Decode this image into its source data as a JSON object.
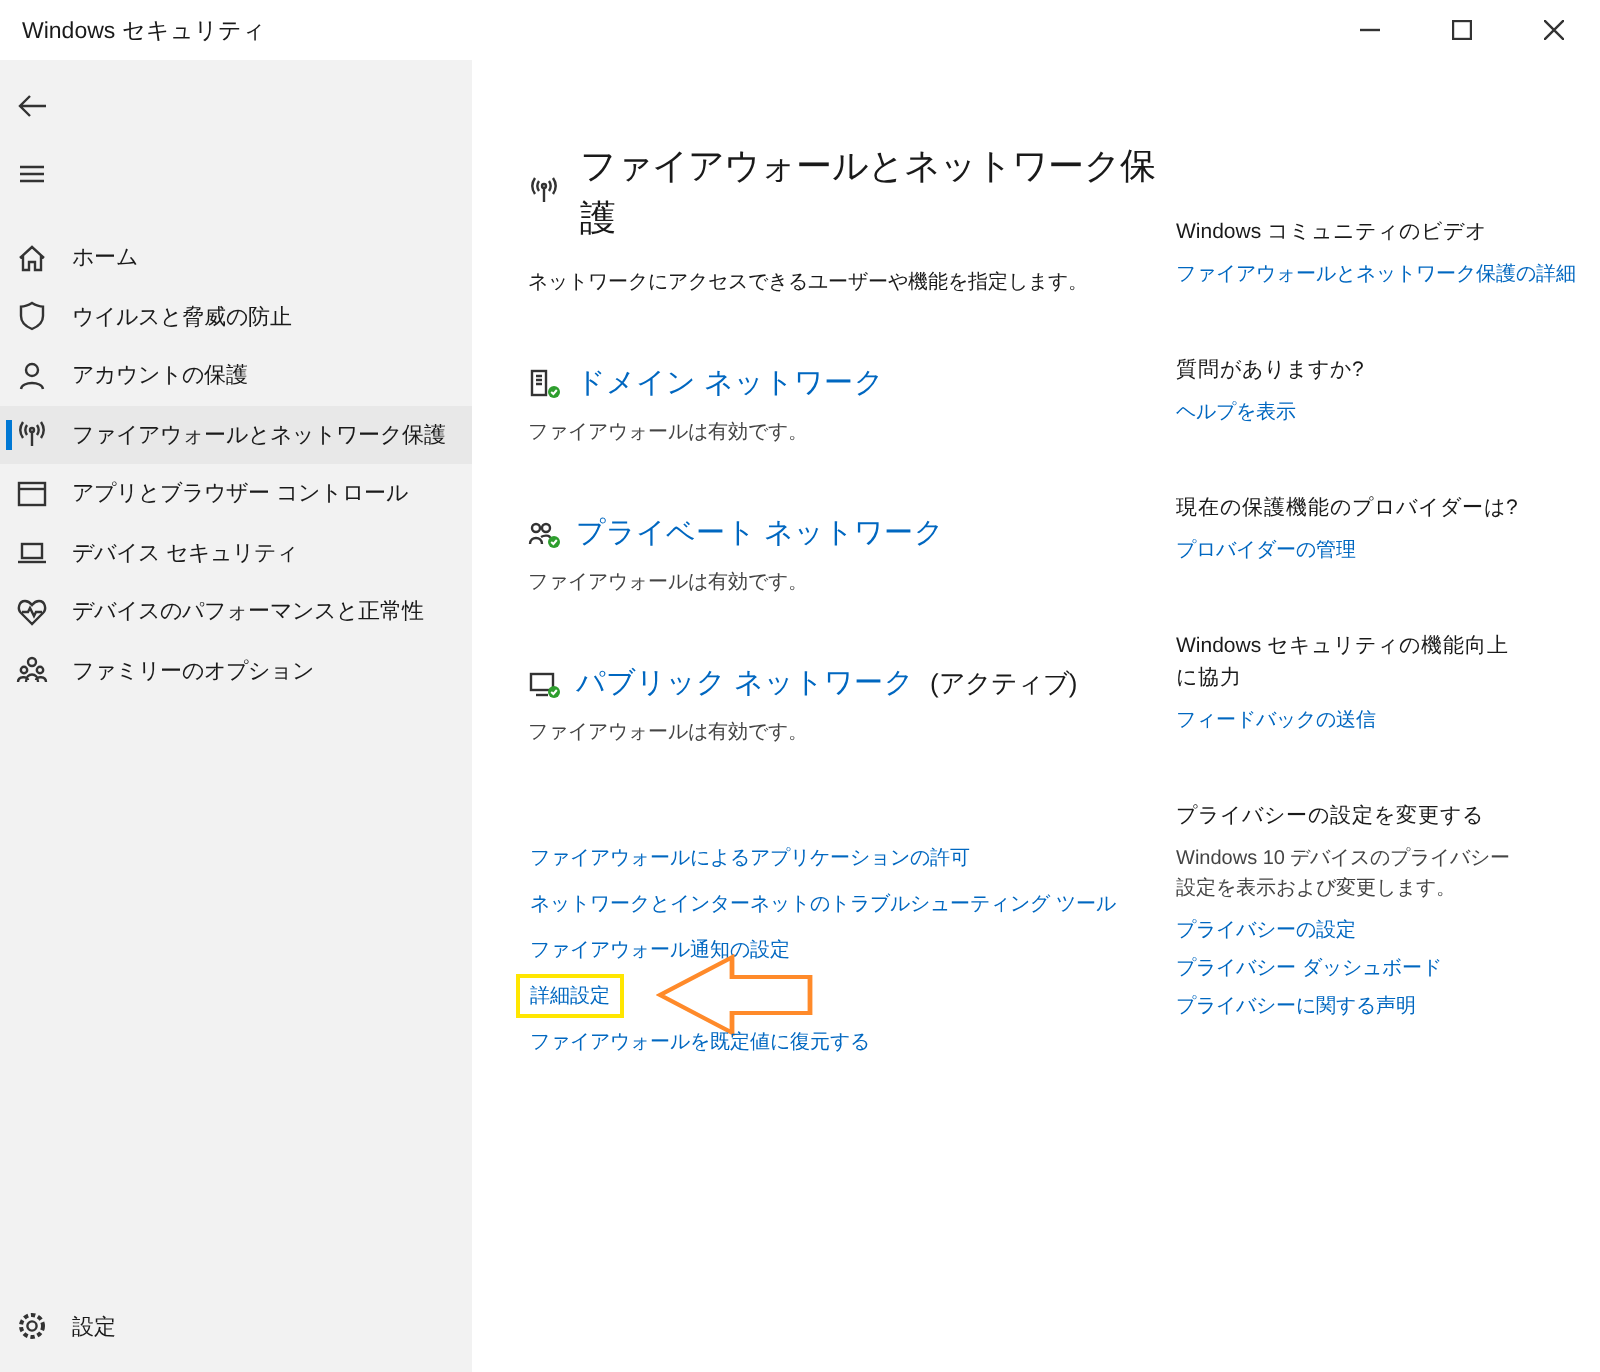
{
  "window": {
    "title": "Windows セキュリティ"
  },
  "sidebar": {
    "items": [
      {
        "label": "ホーム",
        "selected": false
      },
      {
        "label": "ウイルスと脅威の防止",
        "selected": false
      },
      {
        "label": "アカウントの保護",
        "selected": false
      },
      {
        "label": "ファイアウォールとネットワーク保護",
        "selected": true
      },
      {
        "label": "アプリとブラウザー コントロール",
        "selected": false
      },
      {
        "label": "デバイス セキュリティ",
        "selected": false
      },
      {
        "label": "デバイスのパフォーマンスと正常性",
        "selected": false
      },
      {
        "label": "ファミリーのオプション",
        "selected": false
      }
    ],
    "settings": {
      "label": "設定"
    }
  },
  "page": {
    "title": "ファイアウォールとネットワーク保護",
    "description": "ネットワークにアクセスできるユーザーや機能を指定します。",
    "networks": [
      {
        "name": "ドメイン ネットワーク",
        "status": "ファイアウォールは有効です。"
      },
      {
        "name": "プライベート ネットワーク",
        "status": "ファイアウォールは有効です。"
      },
      {
        "name": "パブリック ネットワーク",
        "note": "(アクティブ)",
        "status": "ファイアウォールは有効です。"
      }
    ],
    "links": [
      {
        "label": "ファイアウォールによるアプリケーションの許可",
        "highlighted": false
      },
      {
        "label": "ネットワークとインターネットのトラブルシューティング ツール",
        "highlighted": false
      },
      {
        "label": "ファイアウォール通知の設定",
        "highlighted": false
      },
      {
        "label": "詳細設定",
        "highlighted": true
      },
      {
        "label": "ファイアウォールを既定値に復元する",
        "highlighted": false
      }
    ]
  },
  "aside": {
    "sections": [
      {
        "heading": "Windows コミュニティのビデオ",
        "links": [
          "ファイアウォールとネットワーク保護の詳細"
        ]
      },
      {
        "heading": "質問がありますか?",
        "links": [
          "ヘルプを表示"
        ]
      },
      {
        "heading": "現在の保護機能のプロバイダーは?",
        "links": [
          "プロバイダーの管理"
        ]
      },
      {
        "heading": "Windows セキュリティの機能向上に協力",
        "links": [
          "フィードバックの送信"
        ]
      },
      {
        "heading": "プライバシーの設定を変更する",
        "description": "Windows 10 デバイスのプライバシー設定を表示および変更します。",
        "links": [
          "プライバシーの設定",
          "プライバシー ダッシュボード",
          "プライバシーに関する声明"
        ]
      }
    ]
  }
}
